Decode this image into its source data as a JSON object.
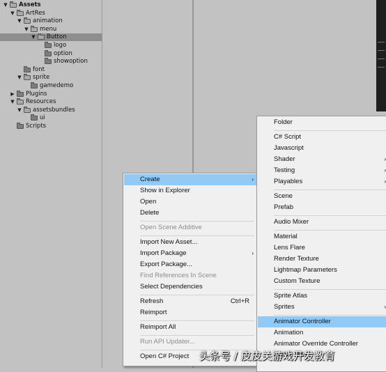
{
  "project_tree": {
    "rows": [
      {
        "label": "Assets",
        "bold": true,
        "indent": 0,
        "arrow": "▼",
        "folder": true,
        "selected": false
      },
      {
        "label": "ArtRes",
        "bold": false,
        "indent": 1,
        "arrow": "▼",
        "folder": true,
        "selected": false
      },
      {
        "label": "animation",
        "bold": false,
        "indent": 2,
        "arrow": "▼",
        "folder": true,
        "selected": false
      },
      {
        "label": "menu",
        "bold": false,
        "indent": 3,
        "arrow": "▼",
        "folder": true,
        "selected": false
      },
      {
        "label": "Button",
        "bold": false,
        "indent": 4,
        "arrow": "▼",
        "folder": true,
        "selected": true
      },
      {
        "label": "logo",
        "bold": false,
        "indent": 5,
        "arrow": "",
        "folder": true,
        "selected": false
      },
      {
        "label": "option",
        "bold": false,
        "indent": 5,
        "arrow": "",
        "folder": true,
        "selected": false
      },
      {
        "label": "showoption",
        "bold": false,
        "indent": 5,
        "arrow": "",
        "folder": true,
        "selected": false
      },
      {
        "label": "font",
        "bold": false,
        "indent": 2,
        "arrow": "",
        "folder": true,
        "selected": false
      },
      {
        "label": "sprite",
        "bold": false,
        "indent": 2,
        "arrow": "▼",
        "folder": true,
        "selected": false
      },
      {
        "label": "gamedemo",
        "bold": false,
        "indent": 3,
        "arrow": "",
        "folder": true,
        "selected": false
      },
      {
        "label": "Plugins",
        "bold": false,
        "indent": 1,
        "arrow": "▶",
        "folder": true,
        "selected": false
      },
      {
        "label": "Resources",
        "bold": false,
        "indent": 1,
        "arrow": "▼",
        "folder": true,
        "selected": false
      },
      {
        "label": "assetsbundles",
        "bold": false,
        "indent": 2,
        "arrow": "▼",
        "folder": true,
        "selected": false
      },
      {
        "label": "ui",
        "bold": false,
        "indent": 3,
        "arrow": "",
        "folder": true,
        "selected": false
      },
      {
        "label": "Scripts",
        "bold": false,
        "indent": 1,
        "arrow": "",
        "folder": true,
        "selected": false
      }
    ]
  },
  "context_menu": {
    "items": [
      {
        "label": "Create",
        "shortcut": "",
        "submenu": true,
        "disabled": false,
        "highlight": true,
        "sep_before": false
      },
      {
        "label": "Show in Explorer",
        "shortcut": "",
        "submenu": false,
        "disabled": false,
        "highlight": false,
        "sep_before": false
      },
      {
        "label": "Open",
        "shortcut": "",
        "submenu": false,
        "disabled": false,
        "highlight": false,
        "sep_before": false
      },
      {
        "label": "Delete",
        "shortcut": "",
        "submenu": false,
        "disabled": false,
        "highlight": false,
        "sep_before": false
      },
      {
        "label": "Open Scene Additive",
        "shortcut": "",
        "submenu": false,
        "disabled": true,
        "highlight": false,
        "sep_before": true
      },
      {
        "label": "Import New Asset...",
        "shortcut": "",
        "submenu": false,
        "disabled": false,
        "highlight": false,
        "sep_before": true
      },
      {
        "label": "Import Package",
        "shortcut": "",
        "submenu": true,
        "disabled": false,
        "highlight": false,
        "sep_before": false
      },
      {
        "label": "Export Package...",
        "shortcut": "",
        "submenu": false,
        "disabled": false,
        "highlight": false,
        "sep_before": false
      },
      {
        "label": "Find References In Scene",
        "shortcut": "",
        "submenu": false,
        "disabled": true,
        "highlight": false,
        "sep_before": false
      },
      {
        "label": "Select Dependencies",
        "shortcut": "",
        "submenu": false,
        "disabled": false,
        "highlight": false,
        "sep_before": false
      },
      {
        "label": "Refresh",
        "shortcut": "Ctrl+R",
        "submenu": false,
        "disabled": false,
        "highlight": false,
        "sep_before": true
      },
      {
        "label": "Reimport",
        "shortcut": "",
        "submenu": false,
        "disabled": false,
        "highlight": false,
        "sep_before": false
      },
      {
        "label": "Reimport All",
        "shortcut": "",
        "submenu": false,
        "disabled": false,
        "highlight": false,
        "sep_before": true
      },
      {
        "label": "Run API Updater...",
        "shortcut": "",
        "submenu": false,
        "disabled": true,
        "highlight": false,
        "sep_before": true
      },
      {
        "label": "Open C# Project",
        "shortcut": "",
        "submenu": false,
        "disabled": false,
        "highlight": false,
        "sep_before": true
      }
    ]
  },
  "create_submenu": {
    "items": [
      {
        "label": "Folder",
        "submenu": false,
        "highlight": false,
        "sep_before": false
      },
      {
        "label": "C# Script",
        "submenu": false,
        "highlight": false,
        "sep_before": true
      },
      {
        "label": "Javascript",
        "submenu": false,
        "highlight": false,
        "sep_before": false
      },
      {
        "label": "Shader",
        "submenu": true,
        "highlight": false,
        "sep_before": false
      },
      {
        "label": "Testing",
        "submenu": true,
        "highlight": false,
        "sep_before": false
      },
      {
        "label": "Playables",
        "submenu": true,
        "highlight": false,
        "sep_before": false
      },
      {
        "label": "Scene",
        "submenu": false,
        "highlight": false,
        "sep_before": true
      },
      {
        "label": "Prefab",
        "submenu": false,
        "highlight": false,
        "sep_before": false
      },
      {
        "label": "Audio Mixer",
        "submenu": false,
        "highlight": false,
        "sep_before": true
      },
      {
        "label": "Material",
        "submenu": false,
        "highlight": false,
        "sep_before": true
      },
      {
        "label": "Lens Flare",
        "submenu": false,
        "highlight": false,
        "sep_before": false
      },
      {
        "label": "Render Texture",
        "submenu": false,
        "highlight": false,
        "sep_before": false
      },
      {
        "label": "Lightmap Parameters",
        "submenu": false,
        "highlight": false,
        "sep_before": false
      },
      {
        "label": "Custom Texture",
        "submenu": false,
        "highlight": false,
        "sep_before": false
      },
      {
        "label": "Sprite Atlas",
        "submenu": false,
        "highlight": false,
        "sep_before": true
      },
      {
        "label": "Sprites",
        "submenu": true,
        "highlight": false,
        "sep_before": false
      },
      {
        "label": "Animator Controller",
        "submenu": false,
        "highlight": true,
        "sep_before": true
      },
      {
        "label": "Animation",
        "submenu": false,
        "highlight": false,
        "sep_before": false
      },
      {
        "label": "Animator Override Controller",
        "submenu": false,
        "highlight": false,
        "sep_before": false
      },
      {
        "label": "Avatar Mask",
        "submenu": false,
        "highlight": false,
        "sep_before": false
      }
    ]
  },
  "glyphs": {
    "submenu_arrow": "›"
  },
  "watermark": "头条号 / 皮皮关游戏开发教育"
}
